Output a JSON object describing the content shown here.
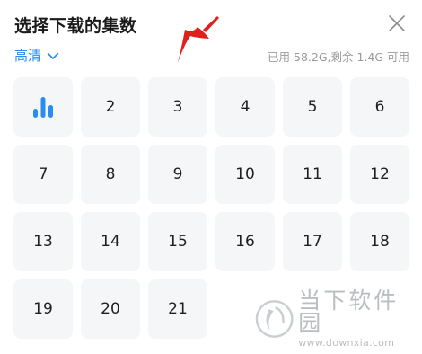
{
  "header": {
    "title": "选择下载的集数"
  },
  "quality": {
    "label": "高清"
  },
  "storage": {
    "text": "已用 58.2G,剩余 1.4G 可用"
  },
  "episodes": [
    "",
    "2",
    "3",
    "4",
    "5",
    "6",
    "7",
    "8",
    "9",
    "10",
    "11",
    "12",
    "13",
    "14",
    "15",
    "16",
    "17",
    "18",
    "19",
    "20",
    "21"
  ],
  "watermark": {
    "name": "当下软件园",
    "url": "www.downxia.com"
  },
  "colors": {
    "accent": "#2a8df2",
    "arrow": "#e0201c",
    "cell_bg": "#f5f6f8"
  }
}
